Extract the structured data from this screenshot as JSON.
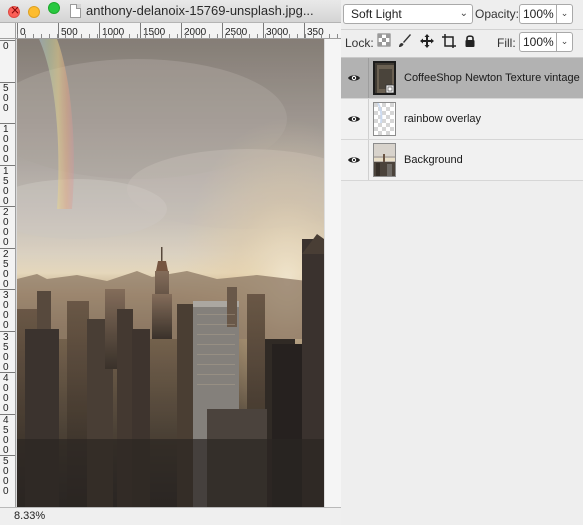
{
  "window": {
    "title": "anthony-delanoix-15769-unsplash.jpg...",
    "zoom": "8.33%"
  },
  "rulers": {
    "top_ticks": [
      "0",
      "500",
      "1000",
      "1500",
      "2000",
      "2500",
      "3000",
      "350"
    ],
    "left_groups": [
      [
        "0"
      ],
      [
        "5",
        "0",
        "0"
      ],
      [
        "1",
        "0",
        "0",
        "0"
      ],
      [
        "1",
        "5",
        "0",
        "0"
      ],
      [
        "2",
        "0",
        "0",
        "0"
      ],
      [
        "2",
        "5",
        "0",
        "0"
      ],
      [
        "3",
        "0",
        "0",
        "0"
      ],
      [
        "3",
        "5",
        "0",
        "0"
      ],
      [
        "4",
        "0",
        "0",
        "0"
      ],
      [
        "4",
        "5",
        "0",
        "0"
      ],
      [
        "5",
        "0",
        "0",
        "0"
      ]
    ]
  },
  "layers_panel": {
    "blend_mode": "Soft Light",
    "opacity_label": "Opacity:",
    "opacity_value": "100%",
    "lock_label": "Lock:",
    "fill_label": "Fill:",
    "fill_value": "100%",
    "lock_icons": [
      "lock-transparent-icon",
      "lock-paint-icon",
      "lock-move-icon",
      "lock-artboard-icon",
      "lock-all-icon"
    ],
    "layers": [
      {
        "name": "CoffeeShop Newton Texture vintage",
        "selected": true,
        "visible": true
      },
      {
        "name": "rainbow overlay",
        "selected": false,
        "visible": true
      },
      {
        "name": "Background",
        "selected": false,
        "visible": true
      }
    ]
  }
}
